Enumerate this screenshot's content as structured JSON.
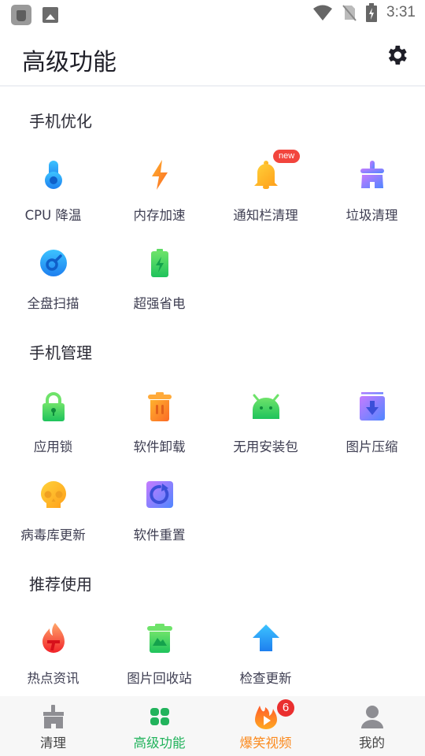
{
  "status_bar": {
    "time": "3:31",
    "icons": [
      "app-notification-icon",
      "image-notification-icon",
      "wifi-icon",
      "no-sim-icon",
      "battery-charging-icon"
    ]
  },
  "app_bar": {
    "title": "高级功能",
    "settings_icon": "gear-icon"
  },
  "sections": [
    {
      "title": "手机优化",
      "items": [
        {
          "label": "CPU 降温",
          "icon": "thermometer-icon"
        },
        {
          "label": "内存加速",
          "icon": "lightning-icon"
        },
        {
          "label": "通知栏清理",
          "icon": "bell-icon",
          "badge": "new"
        },
        {
          "label": "垃圾清理",
          "icon": "broom-icon"
        },
        {
          "label": "全盘扫描",
          "icon": "scan-icon"
        },
        {
          "label": "超强省电",
          "icon": "battery-icon"
        }
      ]
    },
    {
      "title": "手机管理",
      "items": [
        {
          "label": "应用锁",
          "icon": "lock-icon"
        },
        {
          "label": "软件卸载",
          "icon": "trash-icon"
        },
        {
          "label": "无用安装包",
          "icon": "android-icon"
        },
        {
          "label": "图片压缩",
          "icon": "compress-icon"
        },
        {
          "label": "病毒库更新",
          "icon": "skull-icon"
        },
        {
          "label": "软件重置",
          "icon": "reset-icon"
        }
      ]
    },
    {
      "title": "推荐使用",
      "items": [
        {
          "label": "热点资讯",
          "icon": "flame-icon"
        },
        {
          "label": "图片回收站",
          "icon": "photo-recycle-icon"
        },
        {
          "label": "检查更新",
          "icon": "arrow-up-icon"
        }
      ]
    }
  ],
  "bottom_nav": [
    {
      "label": "清理",
      "icon": "broom-icon",
      "active": false
    },
    {
      "label": "高级功能",
      "icon": "clover-icon",
      "active": true
    },
    {
      "label": "爆笑视频",
      "icon": "video-flame-icon",
      "badge": "6"
    },
    {
      "label": "我的",
      "icon": "person-icon",
      "active": false
    }
  ],
  "colors": {
    "active_tab": "#22b35c",
    "hot_tab": "#fb8a1e",
    "badge_red": "#f2453d"
  }
}
